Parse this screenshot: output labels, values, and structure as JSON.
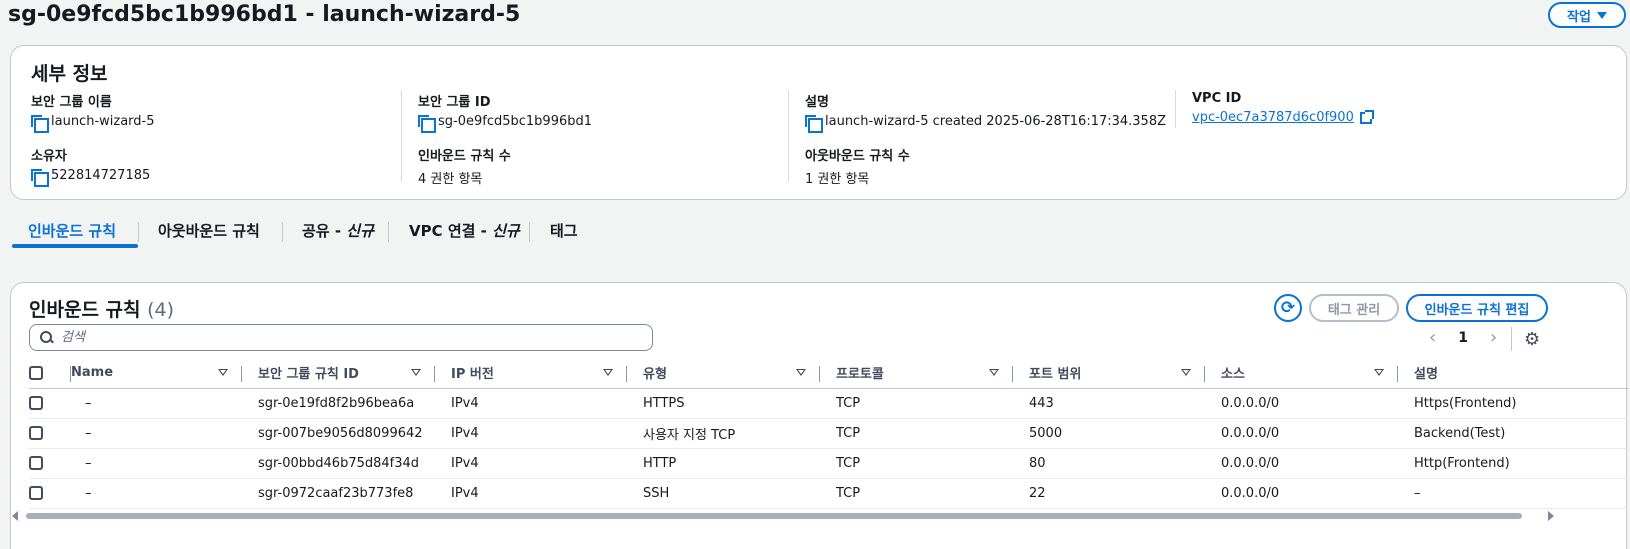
{
  "page": {
    "title": "sg-0e9fcd5bc1b996bd1 - launch-wizard-5",
    "actions_label": "작업"
  },
  "details": {
    "title": "세부 정보",
    "fields": [
      {
        "key": "보안 그룹 이름",
        "value": "launch-wizard-5"
      },
      {
        "key": "보안 그룹 ID",
        "value": "sg-0e9fcd5bc1b996bd1"
      },
      {
        "key": "설명",
        "value": "launch-wizard-5 created 2025-06-28T16:17:34.358Z"
      },
      {
        "key": "VPC ID",
        "value": "vpc-0ec7a3787d6c0f900"
      },
      {
        "key": "소유자",
        "value": "522814727185"
      },
      {
        "key": "인바운드 규칙 수",
        "value": "4 권한 항목"
      },
      {
        "key": "아웃바운드 규칙 수",
        "value": "1 권한 항목"
      }
    ]
  },
  "tabs": [
    {
      "label": "인바운드 규칙"
    },
    {
      "label": "아웃바운드 규칙"
    },
    {
      "label": "공유 - ",
      "badge": "신규"
    },
    {
      "label": "VPC 연결 - ",
      "badge": "신규"
    },
    {
      "label": "태그"
    }
  ],
  "rules": {
    "title": "인바운드 규칙",
    "count": "(4)",
    "manage_tags_label": "태그 관리",
    "edit_rules_label": "인바운드 규칙 편집",
    "search_placeholder": "검색",
    "page_number": "1",
    "columns": [
      "Name",
      "보안 그룹 규칙 ID",
      "IP 버전",
      "유형",
      "프로토콜",
      "포트 범위",
      "소스",
      "설명"
    ],
    "rows": [
      {
        "name": "–",
        "rule_id": "sgr-0e19fd8f2b96bea6a",
        "ip_version": "IPv4",
        "type": "HTTPS",
        "protocol": "TCP",
        "port_range": "443",
        "source": "0.0.0.0/0",
        "description": "Https(Frontend)"
      },
      {
        "name": "–",
        "rule_id": "sgr-007be9056d8099642",
        "ip_version": "IPv4",
        "type": "사용자 지정 TCP",
        "protocol": "TCP",
        "port_range": "5000",
        "source": "0.0.0.0/0",
        "description": "Backend(Test)"
      },
      {
        "name": "–",
        "rule_id": "sgr-00bbd46b75d84f34d",
        "ip_version": "IPv4",
        "type": "HTTP",
        "protocol": "TCP",
        "port_range": "80",
        "source": "0.0.0.0/0",
        "description": "Http(Frontend)"
      },
      {
        "name": "–",
        "rule_id": "sgr-0972caaf23b773fe8",
        "ip_version": "IPv4",
        "type": "SSH",
        "protocol": "TCP",
        "port_range": "22",
        "source": "0.0.0.0/0",
        "description": "–"
      }
    ]
  },
  "colors": {
    "accent": "#0972d3",
    "text": "#16191f",
    "background": "#f2f3f3"
  }
}
